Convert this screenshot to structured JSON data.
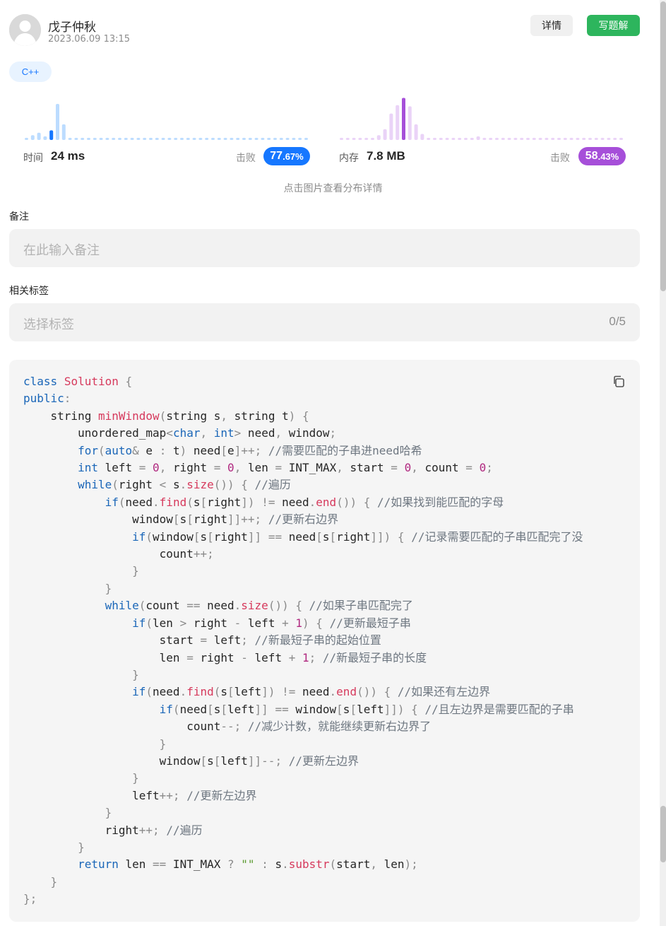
{
  "header": {
    "author": "戊子仲秋",
    "date": "2023.06.09 13:15",
    "detail_label": "详情",
    "write_label": "写题解",
    "lang_tag": "C++"
  },
  "stats": {
    "time": {
      "label": "时间",
      "value": "24 ms",
      "beat_label": "击败",
      "beat_percent": "77.67%",
      "beat_int": "77",
      "beat_frac": ".67%",
      "color": "#1677ff"
    },
    "memory": {
      "label": "内存",
      "value": "7.8 MB",
      "beat_label": "击败",
      "beat_percent": "58.43%",
      "beat_int": "58",
      "beat_frac": ".43%",
      "color": "#a64fd9"
    },
    "hint": "点击图片查看分布详情"
  },
  "chart_data": [
    {
      "type": "bar",
      "series": [
        {
          "values": [
            1,
            4,
            6,
            3,
            8,
            30,
            13,
            1,
            1,
            1,
            1,
            1,
            1,
            1,
            1,
            1,
            1,
            1,
            1,
            1,
            1,
            1,
            1,
            1,
            1,
            1,
            1,
            1,
            1,
            1,
            1,
            1,
            1,
            1,
            1,
            1,
            1,
            1,
            1,
            1,
            1,
            1,
            1,
            1,
            1,
            1
          ]
        }
      ],
      "highlight_index": 4,
      "colors": {
        "bar": "#bcdcff",
        "highlight": "#1677ff"
      }
    },
    {
      "type": "bar",
      "series": [
        {
          "values": [
            1,
            1,
            1,
            1,
            1,
            1,
            4,
            9,
            22,
            29,
            35,
            28,
            13,
            5,
            1,
            1,
            1,
            1,
            1,
            1,
            1,
            1,
            3,
            1,
            1,
            1,
            1,
            1,
            1,
            1,
            1,
            1,
            1,
            1,
            1,
            1,
            1,
            1,
            1,
            1,
            1,
            1,
            1,
            1,
            1,
            1
          ]
        }
      ],
      "highlight_index": 10,
      "colors": {
        "bar": "#ead3f7",
        "highlight": "#a64fd9"
      }
    }
  ],
  "form": {
    "note_label": "备注",
    "note_placeholder": "在此输入备注",
    "tags_label": "相关标签",
    "tags_placeholder": "选择标签",
    "tags_counter": "0/5"
  },
  "code": {
    "icon": "copy-icon",
    "text": "class Solution {\npublic:\n    string minWindow(string s, string t) {\n        unordered_map<char, int> need, window;\n        for(auto& e : t) need[e]++; //需要匹配的子串进need哈希\n        int left = 0, right = 0, len = INT_MAX, start = 0, count = 0;\n        while(right < s.size()) { //遍历\n            if(need.find(s[right]) != need.end()) { //如果找到能匹配的字母\n                window[s[right]]++; //更新右边界\n                if(window[s[right]] == need[s[right]]) { //记录需要匹配的子串匹配完了没\n                    count++;\n                }\n            }\n            while(count == need.size()) { //如果子串匹配完了\n                if(len > right - left + 1) { //更新最短子串\n                    start = left; //新最短子串的起始位置\n                    len = right - left + 1; //新最短子串的长度\n                }\n                if(need.find(s[left]) != need.end()) { //如果还有左边界\n                    if(need[s[left]] == window[s[left]]) { //且左边界是需要匹配的子串\n                        count--; //减少计数，就能继续更新右边界了\n                    }\n                    window[s[left]]--; //更新左边界\n                }\n                left++; //更新左边界\n            }\n            right++; //遍历\n        }\n        return len == INT_MAX ? \"\" : s.substr(start, len);\n    }\n};"
  }
}
